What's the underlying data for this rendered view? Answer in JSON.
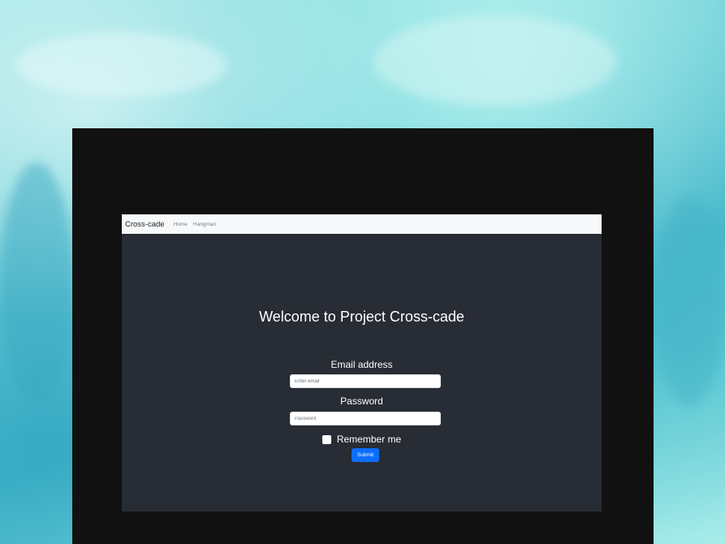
{
  "navbar": {
    "brand": "Cross-cade",
    "links": [
      "Home",
      "Hangman"
    ]
  },
  "main": {
    "title": "Welcome to Project Cross-cade"
  },
  "form": {
    "email_label": "Email address",
    "email_placeholder": "Enter email",
    "password_label": "Password",
    "password_placeholder": "Password",
    "remember_label": "Remember me",
    "submit_label": "Submit"
  },
  "colors": {
    "navbar_bg": "#f8f9fa",
    "app_bg": "#282c34",
    "frame_bg": "#111111",
    "primary": "#0d6efd"
  }
}
